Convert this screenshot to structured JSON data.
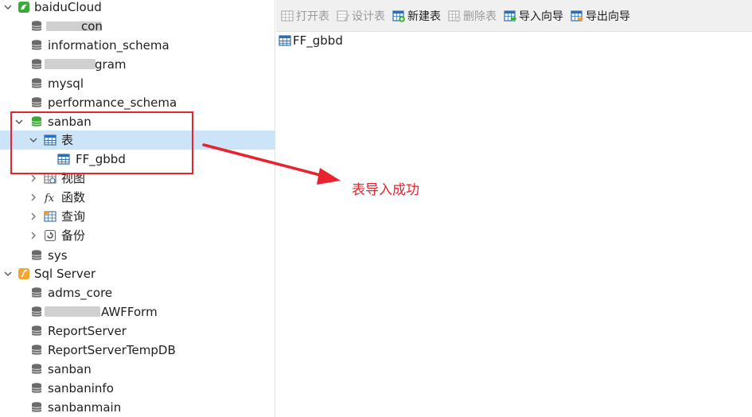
{
  "sidebar": {
    "root1_label": "baiduCloud",
    "db_partial_1": "con",
    "db_information_schema": "information_schema",
    "db_partial_2": "gram",
    "db_mysql": "mysql",
    "db_performance_schema": "performance_schema",
    "db_sanban": "sanban",
    "folder_tables": "表",
    "table_ff_gbbd": "FF_gbbd",
    "folder_views": "视图",
    "folder_functions": "函数",
    "folder_queries": "查询",
    "folder_backups": "备份",
    "db_sys": "sys",
    "root2_label": "Sql Server",
    "ss_adms_core": "adms_core",
    "ss_partial_awfform": "AWFForm",
    "ss_reportserver": "ReportServer",
    "ss_reportservertempdb": "ReportServerTempDB",
    "ss_sanban": "sanban",
    "ss_sanbaninfo": "sanbaninfo",
    "ss_sanbanmain": "sanbanmain"
  },
  "toolbar": {
    "open_table": "打开表",
    "design_table": "设计表",
    "new_table": "新建表",
    "delete_table": "删除表",
    "import_wizard": "导入向导",
    "export_wizard": "导出向导"
  },
  "content": {
    "items": [
      "FF_gbbd"
    ]
  },
  "annotation": {
    "text": "表导入成功",
    "color": "#e8232f"
  },
  "colors": {
    "selection": "#cce4f7",
    "db_green": "#3aaa35",
    "annotation_red": "#e8232f",
    "toolbar_bg": "#f0f0f0"
  }
}
